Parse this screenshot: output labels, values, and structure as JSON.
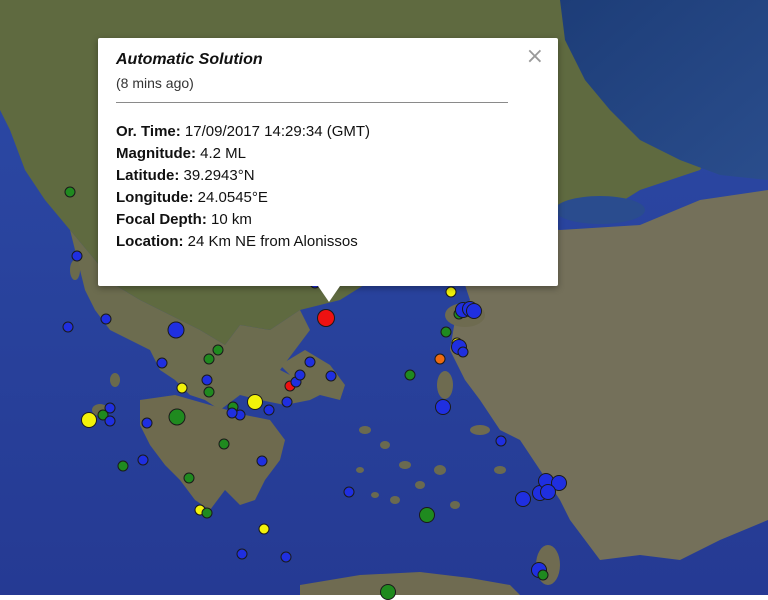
{
  "popup": {
    "title": "Automatic Solution",
    "subtitle": "(8 mins ago)",
    "close_symbol": "×",
    "rows": [
      {
        "label": "Or. Time:",
        "value": " 17/09/2017  14:29:34 (GMT)"
      },
      {
        "label": "Magnitude:",
        "value": " 4.2 ML"
      },
      {
        "label": "Latitude:",
        "value": " 39.2943°N"
      },
      {
        "label": "Longitude:",
        "value": " 24.0545°E"
      },
      {
        "label": "Focal Depth:",
        "value": " 10 km"
      },
      {
        "label": "Location:",
        "value": " 24 Km NE from Alonissos"
      }
    ]
  },
  "colors": {
    "sea": "#2a3f9e",
    "land": "#6f6e52",
    "land_north": "#5e6b3e",
    "marker_blue": "#1f2fe0",
    "marker_green": "#1f8a1f",
    "marker_yellow": "#f2f20a",
    "marker_red": "#ee1111",
    "marker_orange": "#ee6a10"
  }
}
